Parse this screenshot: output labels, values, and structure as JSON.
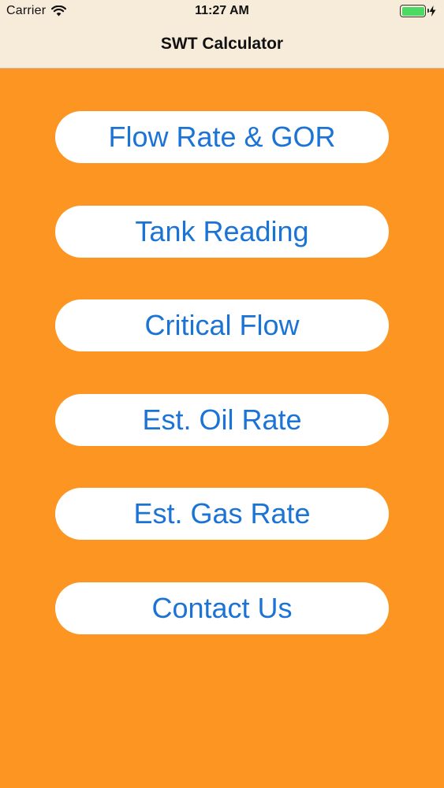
{
  "status_bar": {
    "carrier": "Carrier",
    "time": "11:27 AM",
    "wifi_icon": "wifi-icon",
    "battery_icon": "battery-icon",
    "charging_icon": "bolt-icon",
    "battery_level": 1.0
  },
  "nav": {
    "title": "SWT Calculator"
  },
  "colors": {
    "background": "#fd9522",
    "header": "#f7ebda",
    "button_bg": "#ffffff",
    "button_text": "#1b73d6",
    "battery": "#4cd964"
  },
  "menu": {
    "flow_rate_gor": "Flow Rate & GOR",
    "tank_reading": "Tank Reading",
    "critical_flow": "Critical Flow",
    "est_oil_rate": "Est. Oil Rate",
    "est_gas_rate": "Est. Gas Rate",
    "contact_us": "Contact Us"
  }
}
